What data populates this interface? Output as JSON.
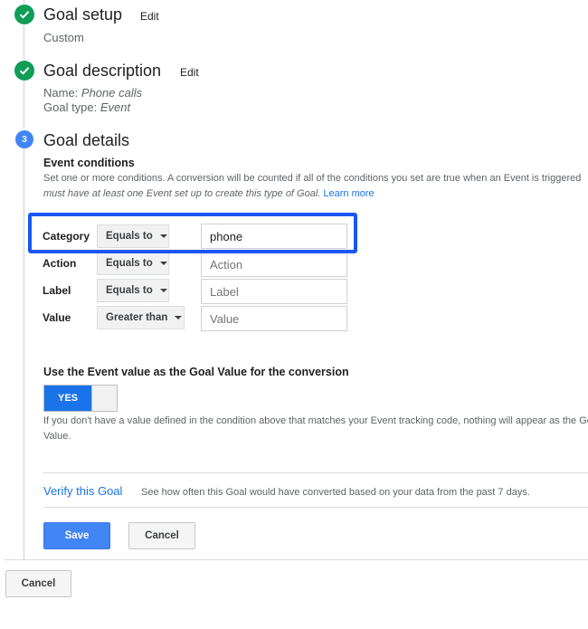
{
  "steps": {
    "setup": {
      "title": "Goal setup",
      "edit_label": "Edit",
      "summary": "Custom"
    },
    "description": {
      "title": "Goal description",
      "edit_label": "Edit",
      "name_label": "Name: ",
      "name_value": "Phone calls",
      "type_label": "Goal type: ",
      "type_value": "Event"
    },
    "details": {
      "number": "3",
      "title": "Goal details"
    }
  },
  "event_conditions": {
    "heading": "Event conditions",
    "description_line1": "Set one or more conditions. A conversion will be counted if all of the conditions you set are true when an Event is triggered",
    "description_line2": "must have at least one Event set up to create this type of Goal.",
    "learn_more": "Learn more",
    "rows": [
      {
        "label": "Category",
        "operator": "Equals to",
        "value": "phone",
        "placeholder": "Category"
      },
      {
        "label": "Action",
        "operator": "Equals to",
        "value": "",
        "placeholder": "Action"
      },
      {
        "label": "Label",
        "operator": "Equals to",
        "value": "",
        "placeholder": "Label"
      },
      {
        "label": "Value",
        "operator": "Greater than",
        "value": "",
        "placeholder": "Value"
      }
    ]
  },
  "goal_value": {
    "heading": "Use the Event value as the Goal Value for the conversion",
    "toggle_label": "YES",
    "toggle_state": "on",
    "note_line1": "If you don't have a value defined in the condition above that matches your Event tracking code, nothing will appear as the Goal",
    "note_line2": "Value."
  },
  "verify": {
    "link": "Verify this Goal",
    "text": "See how often this Goal would have converted based on your data from the past 7 days."
  },
  "buttons": {
    "save": "Save",
    "cancel": "Cancel",
    "outer_cancel": "Cancel"
  },
  "colors": {
    "check_green": "#0f9d58",
    "step_blue": "#4285f4",
    "link_blue": "#1a73e8",
    "highlight": "#1a56f0"
  }
}
